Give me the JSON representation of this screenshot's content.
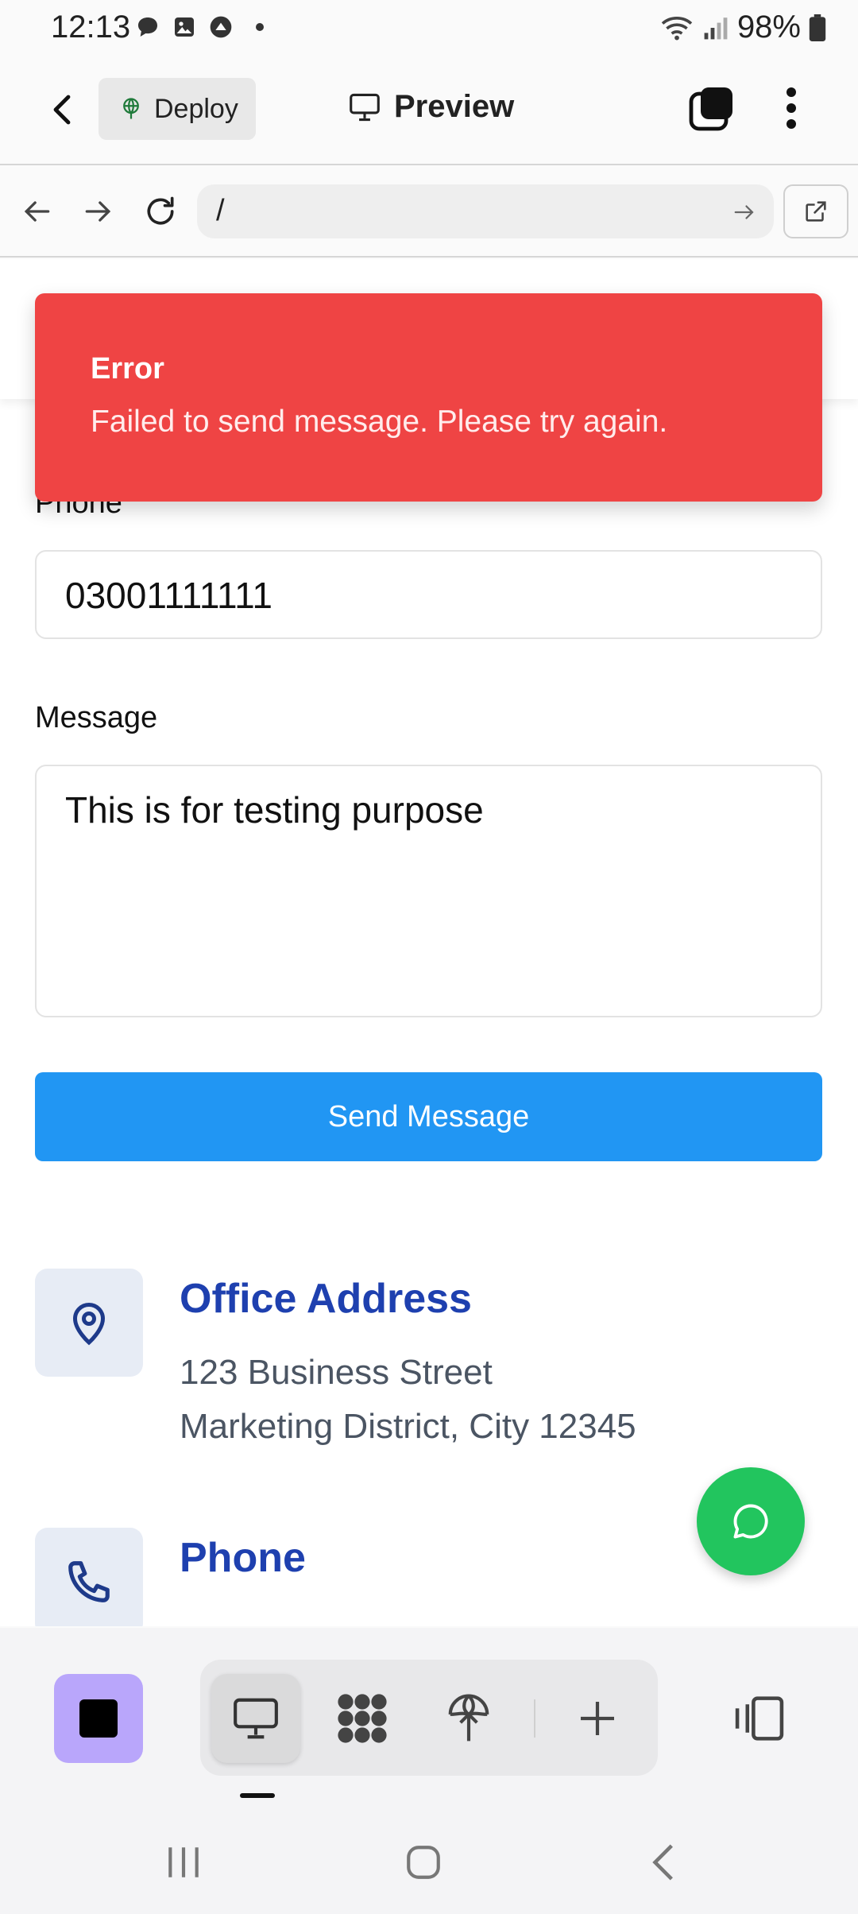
{
  "status_bar": {
    "time": "12:13",
    "battery": "98%",
    "notification_icons": [
      "chat-icon",
      "image-icon",
      "upload-icon",
      "dot-icon"
    ]
  },
  "app_bar": {
    "deploy_label": "Deploy",
    "preview_label": "Preview"
  },
  "browser": {
    "url": "/"
  },
  "toast": {
    "title": "Error",
    "message": "Failed to send message. Please try again."
  },
  "form": {
    "phone_label": "Phone",
    "phone_value": "03001111111",
    "message_label": "Message",
    "message_value": "This is for testing purpose",
    "send_label": "Send Message"
  },
  "contact_info": {
    "address_title": "Office Address",
    "address_line1": "123 Business Street",
    "address_line2": "Marketing District, City 12345",
    "phone_title": "Phone"
  },
  "colors": {
    "error_red": "#ef4444",
    "primary_blue": "#2196f3",
    "heading_blue": "#1e40af",
    "whatsapp_green": "#22c55e",
    "stop_purple": "#b9a6fb"
  }
}
